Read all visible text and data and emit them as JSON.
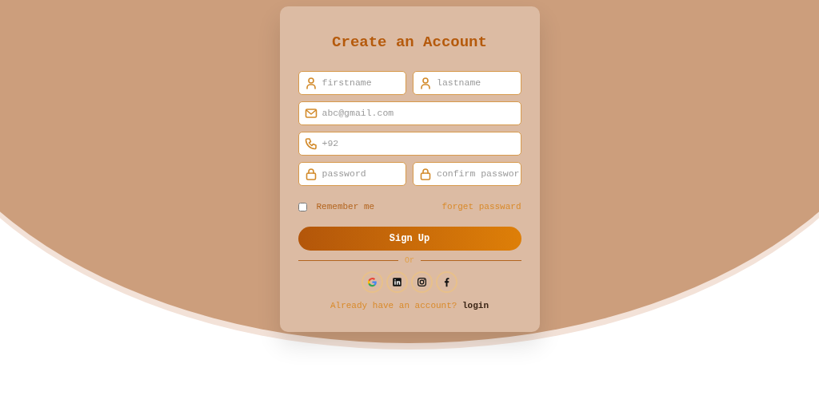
{
  "title": "Create an Account",
  "rows": [
    {
      "fields": [
        {
          "kind": "user",
          "placeholder": "firstname"
        },
        {
          "kind": "user",
          "placeholder": "lastname"
        }
      ]
    },
    {
      "fields": [
        {
          "kind": "mail",
          "placeholder": "abc@gmail.com"
        }
      ]
    },
    {
      "fields": [
        {
          "kind": "phone",
          "placeholder": "+92"
        }
      ]
    },
    {
      "fields": [
        {
          "kind": "lock",
          "placeholder": "password"
        },
        {
          "kind": "lock",
          "placeholder": "confirm passwor"
        }
      ]
    }
  ],
  "remember": {
    "label": "Remember me",
    "checked": false
  },
  "forgot_link": "forget passward",
  "submit": "Sign Up",
  "divider": "Or",
  "socials": [
    {
      "kind": "google"
    },
    {
      "kind": "linkedin"
    },
    {
      "kind": "instagram"
    },
    {
      "kind": "facebook"
    }
  ],
  "footer": {
    "text": "Already have an account?",
    "link": "login"
  }
}
